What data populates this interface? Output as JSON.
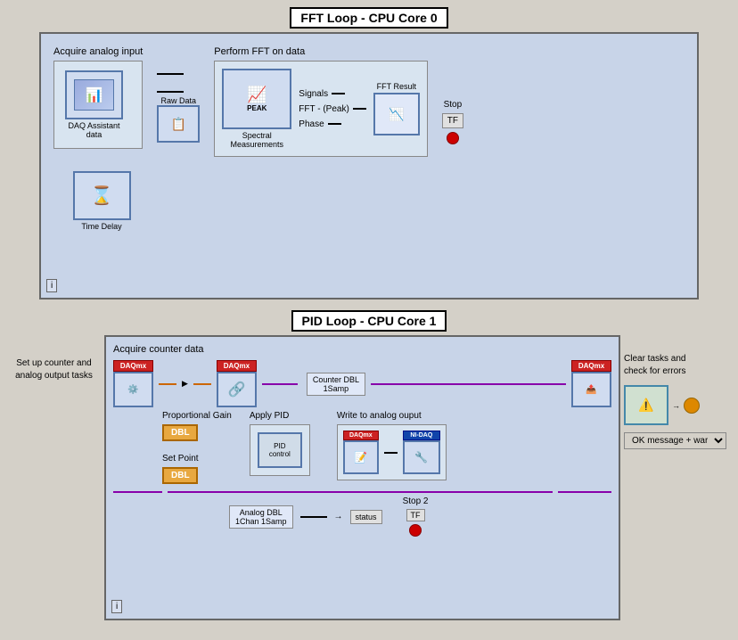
{
  "fft_loop": {
    "title": "FFT Loop - CPU Core 0",
    "acquire_label": "Acquire analog input",
    "perform_label": "Perform FFT on data",
    "daq_label": "DAQ Assistant",
    "daq_sublabel": "data",
    "spectral_label": "Spectral\nMeasurements",
    "spectral_sublabel": "Signals",
    "fft_peak_label": "FFT - (Peak)",
    "phase_label": "Phase",
    "fft_result_label": "FFT Result",
    "raw_data_label": "Raw Data",
    "time_delay_label": "Time Delay",
    "stop_label": "Stop",
    "tf_label": "TF"
  },
  "pid_loop": {
    "title": "PID Loop - CPU Core 1",
    "setup_label": "Set up counter and\nanalog output tasks",
    "acquire_label": "Acquire counter data",
    "clear_label": "Clear tasks and\ncheck for errors",
    "ok_message_label": "OK message + warnings",
    "counter_dbl_label": "Counter DBL\n1Samp",
    "proportional_label": "Proportional Gain",
    "dbl_label1": "DBL",
    "set_point_label": "Set Point",
    "dbl_label2": "DBL",
    "apply_pid_label": "Apply PID",
    "control_label": "PID\ncontrol",
    "write_label": "Write to analog ouput",
    "analog_dbl_label": "Analog DBL\n1Chan 1Samp",
    "stop2_label": "Stop 2",
    "tf2_label": "TF",
    "status_label": "status",
    "daqmx_label": "DAQmx",
    "info_label": "i"
  },
  "colors": {
    "box_bg": "#c8d4e8",
    "inner_bg": "#d8e4f0",
    "title_border": "#000000",
    "wire_orange": "#cc6600",
    "wire_purple": "#8800aa",
    "wire_blue": "#0044cc",
    "accent_red": "#cc2222"
  }
}
